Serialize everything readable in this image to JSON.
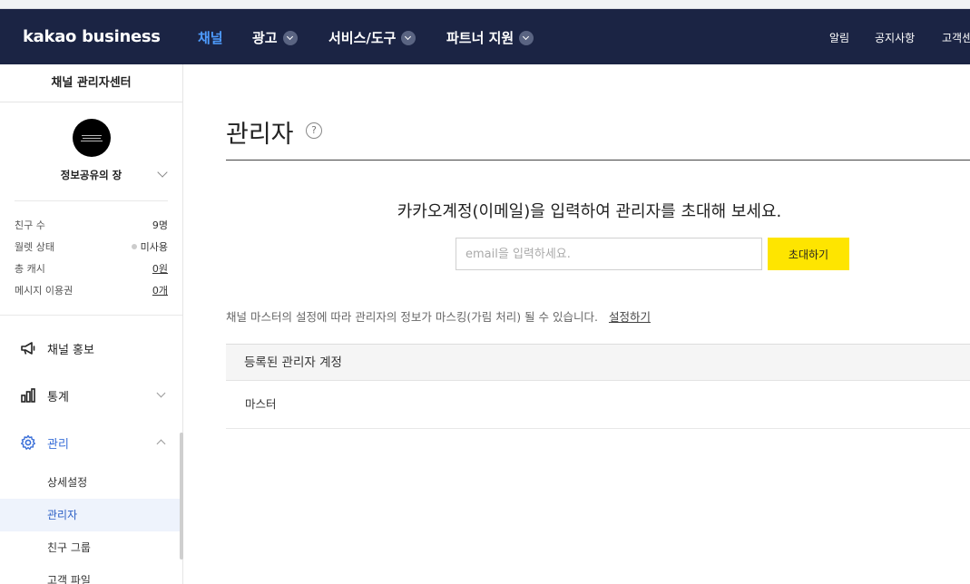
{
  "header": {
    "logo": "kakao business",
    "nav": [
      {
        "label": "채널",
        "active": true,
        "dropdown": false
      },
      {
        "label": "광고",
        "active": false,
        "dropdown": true
      },
      {
        "label": "서비스/도구",
        "active": false,
        "dropdown": true
      },
      {
        "label": "파트너 지원",
        "active": false,
        "dropdown": true
      }
    ],
    "util": [
      "알림",
      "공지사항",
      "고객센터"
    ]
  },
  "sidebar": {
    "title": "채널 관리자센터",
    "channel_name": "정보공유의 장",
    "stats": [
      {
        "label": "친구 수",
        "value": "9명"
      },
      {
        "label": "월렛 상태",
        "value": "미사용"
      },
      {
        "label": "총 캐시",
        "value": "0원"
      },
      {
        "label": "메시지 이용권",
        "value": "0개"
      }
    ],
    "menu": [
      {
        "label": "채널 홍보",
        "icon": "megaphone-icon"
      },
      {
        "label": "통계",
        "icon": "bar-chart-icon"
      },
      {
        "label": "관리",
        "icon": "gear-icon"
      }
    ],
    "submenu": [
      {
        "label": "상세설정"
      },
      {
        "label": "관리자",
        "active": true
      },
      {
        "label": "친구 그룹"
      },
      {
        "label": "고객 파일"
      }
    ]
  },
  "main": {
    "title": "관리자",
    "help_icon": "?",
    "invite_message": "카카오계정(이메일)을 입력하여 관리자를 초대해 보세요.",
    "email_placeholder": "email을 입력하세요.",
    "email_value": "",
    "invite_button": "초대하기",
    "mask_note": "채널 마스터의 설정에 따라 관리자의 정보가 마스킹(가림 처리) 될 수 있습니다.",
    "mask_link": "설정하기",
    "table_header": "등록된 관리자 계정",
    "rows": [
      "마스터"
    ]
  },
  "colors": {
    "header_bg": "#1b2444",
    "active_nav": "#4e9cff",
    "kakao_yellow": "#fee500",
    "active_menu": "#3a6fd8"
  }
}
